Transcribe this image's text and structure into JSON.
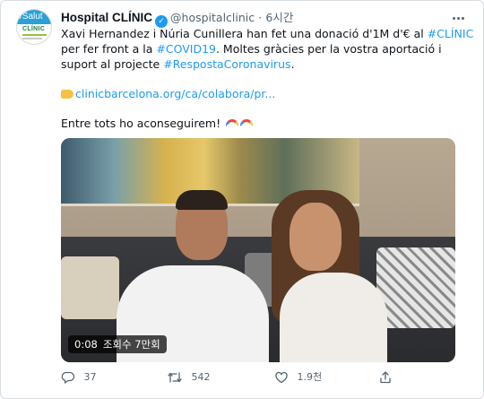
{
  "tweet": {
    "display_name": "Hospital CLÍNIC",
    "handle": "@hospitalclinic",
    "separator": "·",
    "time": "6시간",
    "lines": [
      {
        "parts": [
          {
            "t": "Xavi Hernandez i Núria Cunillera han fet una donació d'1M d'€ al ",
            "link": false
          },
          {
            "t": "#CLÍNIC",
            "link": true
          }
        ]
      },
      {
        "parts": [
          {
            "t": " per fer front a la ",
            "link": false
          },
          {
            "t": "#COVID19",
            "link": true
          },
          {
            "t": ". Moltes gràcies per la vostra aportació i",
            "link": false
          }
        ]
      },
      {
        "parts": [
          {
            "t": "suport al projecte ",
            "link": false
          },
          {
            "t": "#RespostaCoronavirus",
            "link": true
          },
          {
            "t": ".",
            "link": false
          }
        ]
      }
    ],
    "url": "clinicbarcelona.org/ca/colabora/pr...",
    "closing": "Entre tots ho aconseguirem!"
  },
  "avatar": {
    "top_text": "/Salut",
    "brand_text": "CLÍNIC"
  },
  "video": {
    "duration": "0:08",
    "views": "조회수 7만회"
  },
  "actions": {
    "replies": "37",
    "retweets": "542",
    "likes": "1.9천"
  },
  "colors": {
    "link": "#1d9bf0",
    "text": "#0f1419",
    "muted": "#536471",
    "verified": "#1d9bf0"
  },
  "icons": [
    "verified-badge-icon",
    "more-icon",
    "pointing-hand-icon",
    "rainbow-icon",
    "reply-icon",
    "retweet-icon",
    "like-icon",
    "share-icon"
  ]
}
